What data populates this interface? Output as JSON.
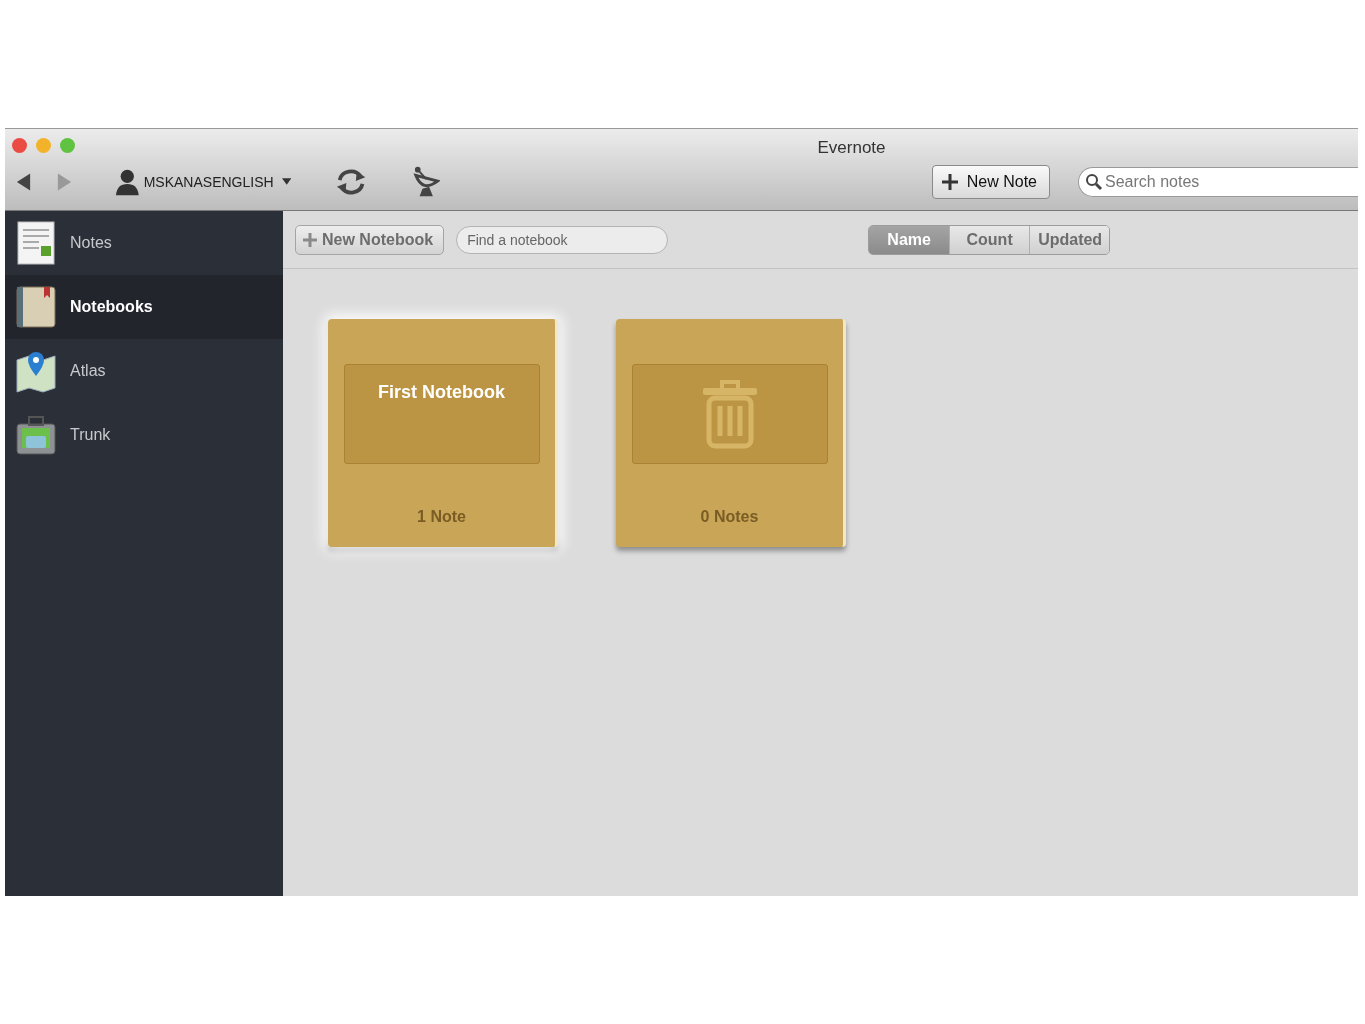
{
  "window": {
    "title": "Evernote"
  },
  "toolbar": {
    "account": "MSKANASENGLISH",
    "new_note": "New Note",
    "search": {
      "placeholder": "Search notes"
    }
  },
  "sidebar": {
    "items": [
      {
        "label": "Notes",
        "selected": false
      },
      {
        "label": "Notebooks",
        "selected": true
      },
      {
        "label": "Atlas",
        "selected": false
      },
      {
        "label": "Trunk",
        "selected": false
      }
    ]
  },
  "notebook_bar": {
    "new_notebook": "New Notebook",
    "find": {
      "placeholder": "Find a notebook"
    },
    "sort": [
      {
        "label": "Name",
        "selected": true
      },
      {
        "label": "Count",
        "selected": false
      },
      {
        "label": "Updated",
        "selected": false
      }
    ]
  },
  "notebooks": [
    {
      "kind": "notebook",
      "title": "First Notebook",
      "count": "1 Note",
      "selected": true
    },
    {
      "kind": "trash",
      "count": "0 Notes",
      "selected": false
    }
  ]
}
